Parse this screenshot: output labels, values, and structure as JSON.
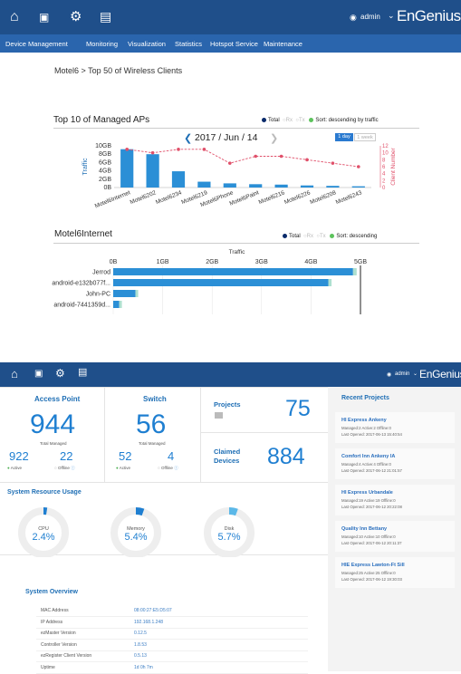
{
  "top_window": {
    "nav_icons": [
      "home-icon",
      "dashboard-icon",
      "gear-icon",
      "clipboard-icon"
    ],
    "user_label": "admin",
    "brand": "EnGenius",
    "menu": [
      "Device Management",
      "Monitoring",
      "Visualization",
      "Statistics",
      "Hotspot Service",
      "Maintenance"
    ],
    "breadcrumb": "Motel6 > Top 50 of Wireless Clients",
    "aps_section": {
      "title": "Top 10 of Managed APs",
      "legend": {
        "total": "Total",
        "rx": "Rx",
        "tx": "Tx",
        "sort": "Sort: descending by traffic"
      },
      "date_label": "2017 / Jun / 14",
      "range_buttons": [
        "1 day",
        "1 week"
      ],
      "colors": {
        "bar": "#2b8fd6",
        "line": "#e0506a",
        "accent": "#1f4f8a"
      }
    },
    "client_section": {
      "title": "Motel6Internet",
      "legend": {
        "total": "Total",
        "rx": "Rx",
        "tx": "Tx",
        "sort": "Sort: descending"
      }
    }
  },
  "chart_data": [
    {
      "type": "bar",
      "title": "Top 10 of Managed APs",
      "ylabel": "Traffic",
      "y2label": "Client Number",
      "y_ticks": [
        "10GB",
        "8GB",
        "6GB",
        "4GB",
        "2GB",
        "0B"
      ],
      "y2_ticks": [
        "12",
        "10",
        "8",
        "6",
        "4",
        "2",
        "0"
      ],
      "ylim": [
        0,
        10
      ],
      "y2lim": [
        0,
        12
      ],
      "categories": [
        "Motel6Internet",
        "Motel6202",
        "Motel6234",
        "Motel6219",
        "Motel6Phone",
        "Motel6Paint",
        "Motel6216",
        "Motel6226",
        "Motel6208",
        "Motel6243"
      ],
      "series": [
        {
          "name": "Total",
          "kind": "bar",
          "values": [
            9.2,
            8.0,
            3.9,
            1.4,
            1.0,
            0.8,
            0.7,
            0.5,
            0.4,
            0.3
          ]
        },
        {
          "name": "Client Number",
          "kind": "line",
          "axis": "y2",
          "values": [
            11,
            10,
            11,
            11,
            7,
            9,
            9,
            8,
            7,
            6
          ]
        }
      ]
    },
    {
      "type": "bar",
      "orientation": "horizontal",
      "title": "Motel6Internet",
      "xlabel": "Traffic",
      "x_ticks": [
        "0B",
        "1GB",
        "2GB",
        "3GB",
        "4GB",
        "5GB"
      ],
      "xlim": [
        0,
        5
      ],
      "categories": [
        "Jerrod",
        "android-e132b077f...",
        "John-PC",
        "android-7441359d..."
      ],
      "series": [
        {
          "name": "Total",
          "values": [
            4.85,
            4.35,
            0.45,
            0.12
          ]
        }
      ]
    }
  ],
  "bottom_window": {
    "nav_icons": [
      "home-icon",
      "dashboard-icon",
      "gear-icon",
      "clipboard-icon"
    ],
    "user_label": "admin",
    "brand": "EnGenius",
    "access_point": {
      "title": "Access Point",
      "total": "944",
      "total_label": "Total Managed",
      "active": "922",
      "active_label": "Active",
      "offline": "22",
      "offline_label": "Offline"
    },
    "switch": {
      "title": "Switch",
      "total": "56",
      "total_label": "Total Managed",
      "active": "52",
      "active_label": "Active",
      "offline": "4",
      "offline_label": "Offline"
    },
    "projects": {
      "label": "Projects",
      "value": "75"
    },
    "claimed": {
      "label_line1": "Claimed",
      "label_line2": "Devices",
      "value": "884"
    },
    "recent_projects": {
      "title": "Recent Projects",
      "items": [
        {
          "name": "HI Express Ankeny",
          "stats": "Managed:2   Active:2   Offline:0",
          "opened": "Last Opened: 2017-06-13 15:40:54"
        },
        {
          "name": "Comfort Inn Ankeny IA",
          "stats": "Managed:4   Active:4   Offline:0",
          "opened": "Last Opened: 2017-06-12 21:01:57"
        },
        {
          "name": "HI Express Urbandale",
          "stats": "Managed:19   Active:19   Offline:0",
          "opened": "Last Opened: 2017-06-12 20:22:08"
        },
        {
          "name": "Quality Inn Bettany",
          "stats": "Managed:10   Active:10   Offline:0",
          "opened": "Last Opened: 2017-06-12 20:11:37"
        },
        {
          "name": "HIE Express Lawton-Ft Sill",
          "stats": "Managed:25   Active:25   Offline:0",
          "opened": "Last Opened: 2017-06-12 19:30:03"
        }
      ]
    },
    "system_resource": {
      "title": "System Resource Usage",
      "gauges": [
        {
          "label": "CPU",
          "value": "2.4%",
          "fraction": 0.024,
          "color": "#1f7fd1"
        },
        {
          "label": "Memory",
          "value": "5.4%",
          "fraction": 0.054,
          "color": "#1f7fd1"
        },
        {
          "label": "Disk",
          "value": "5.7%",
          "fraction": 0.057,
          "color": "#5bb8e8"
        }
      ]
    },
    "system_overview": {
      "title": "System Overview",
      "rows": [
        {
          "label": "MAC Address",
          "value": "08:00:27:E5:D5:07"
        },
        {
          "label": "IP Address",
          "value": "192.168.1.248"
        },
        {
          "label": "ezMaster Version",
          "value": "0.12.5"
        },
        {
          "label": "Controller Version",
          "value": "1.8.53"
        },
        {
          "label": "ezRegister Client Version",
          "value": "0.5.13"
        },
        {
          "label": "Uptime",
          "value": "1d 0h 7m"
        }
      ]
    }
  }
}
